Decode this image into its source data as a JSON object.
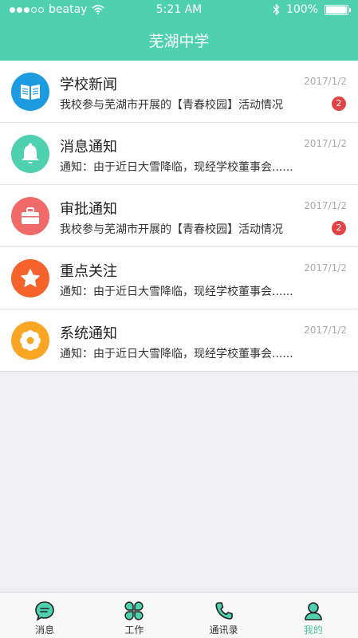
{
  "status_bar": {
    "carrier": "beatay",
    "time": "5:21 AM",
    "battery": "100%"
  },
  "header": {
    "title": "芜湖中学"
  },
  "items": [
    {
      "title": "学校新闻",
      "date": "2017/1/2",
      "subtitle": "我校参与芜湖市开展的【青春校园】活动情况",
      "badge": "2",
      "icon": "book-icon",
      "color": "#1e9ae0"
    },
    {
      "title": "消息通知",
      "date": "2017/1/2",
      "subtitle": "通知：由于近日大雪降临，现经学校董事会......",
      "badge": "",
      "icon": "bell-icon",
      "color": "#4fd1b0"
    },
    {
      "title": "审批通知",
      "date": "2017/1/2",
      "subtitle": "我校参与芜湖市开展的【青春校园】活动情况",
      "badge": "2",
      "icon": "briefcase-icon",
      "color": "#f06a6a"
    },
    {
      "title": "重点关注",
      "date": "2017/1/2",
      "subtitle": "通知：由于近日大雪降临，现经学校董事会......",
      "badge": "",
      "icon": "star-icon",
      "color": "#f5622b"
    },
    {
      "title": "系统通知",
      "date": "2017/1/2",
      "subtitle": "通知：由于近日大雪降临，现经学校董事会......",
      "badge": "",
      "icon": "flower-gear-icon",
      "color": "#f8a623"
    }
  ],
  "tabs": [
    {
      "label": "消息",
      "icon": "chat-icon"
    },
    {
      "label": "工作",
      "icon": "clover-icon"
    },
    {
      "label": "通讯录",
      "icon": "phone-icon"
    },
    {
      "label": "我的",
      "icon": "user-icon",
      "active": true
    }
  ]
}
